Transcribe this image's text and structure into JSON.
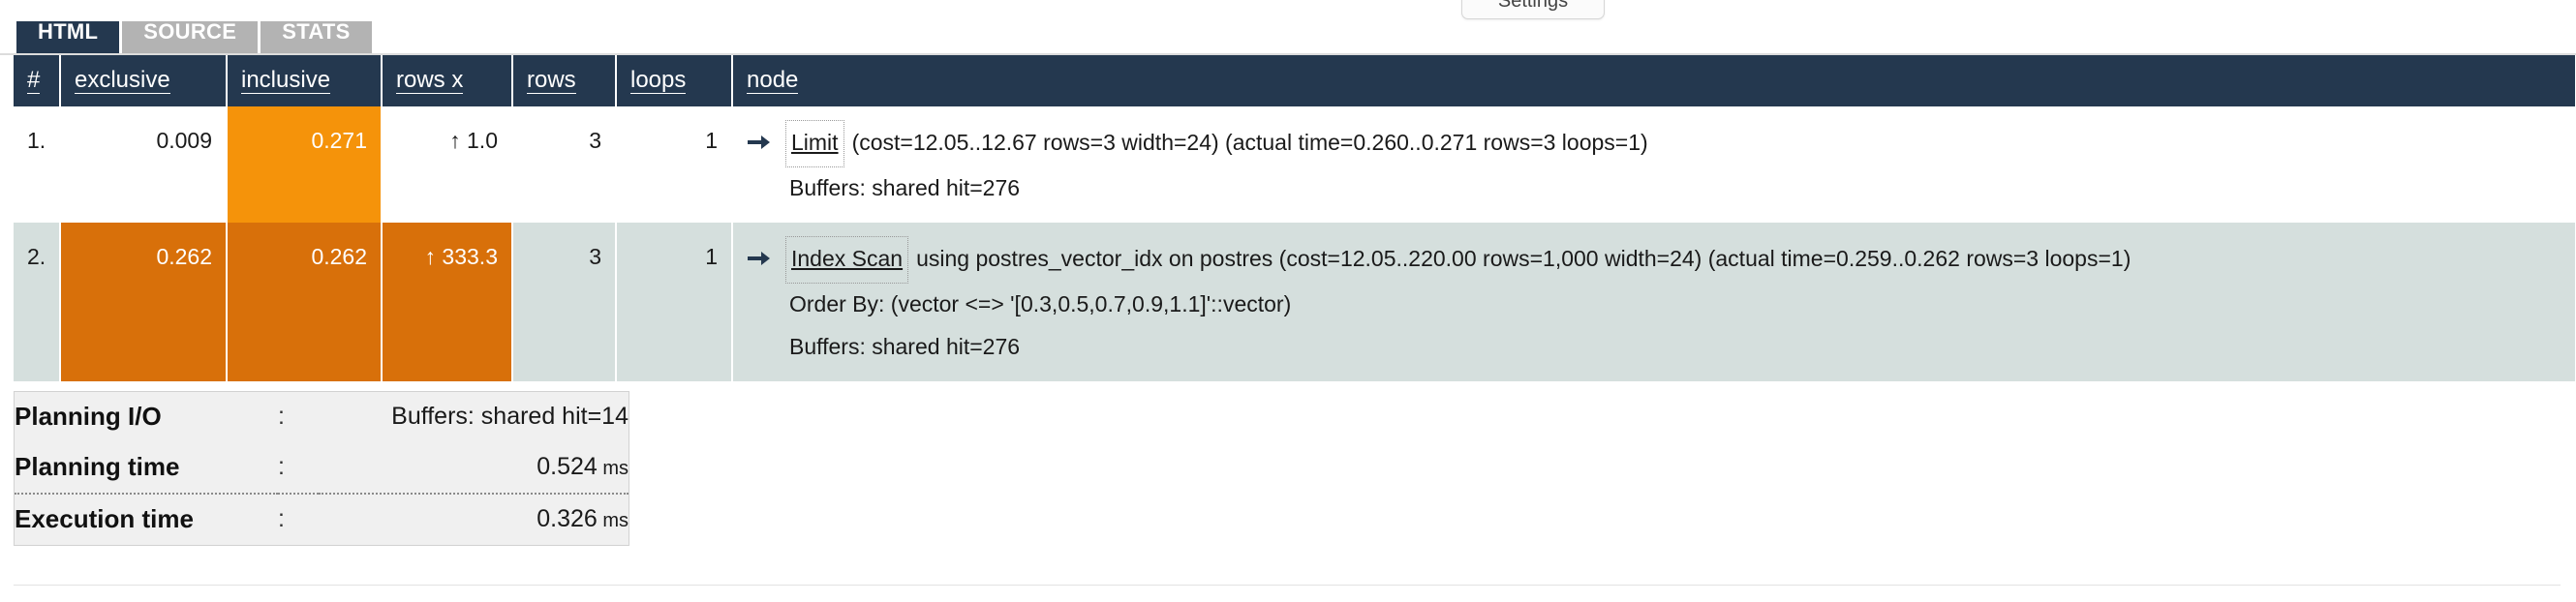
{
  "toolbar": {
    "settings_label": "Settings"
  },
  "tabs": [
    {
      "label": "HTML",
      "active": true
    },
    {
      "label": "SOURCE",
      "active": false
    },
    {
      "label": "STATS",
      "active": false
    }
  ],
  "plan_table": {
    "columns": [
      "#",
      "exclusive",
      "inclusive",
      "rows x",
      "rows",
      "loops",
      "node"
    ],
    "rows": [
      {
        "num": "1.",
        "exclusive": "0.009",
        "inclusive": "0.271",
        "rows_x": "↑ 1.0",
        "rows": "3",
        "loops": "1",
        "node_type": "Limit",
        "node_detail": "(cost=12.05..12.67 rows=3 width=24) (actual time=0.260..0.271 rows=3 loops=1)",
        "extra_lines": [
          "Buffers: shared hit=276"
        ],
        "exclusive_highlight": "none",
        "inclusive_highlight": "orange",
        "rows_x_highlight": "none"
      },
      {
        "num": "2.",
        "exclusive": "0.262",
        "inclusive": "0.262",
        "rows_x": "↑ 333.3",
        "rows": "3",
        "loops": "1",
        "node_type": "Index Scan",
        "node_detail": "using postres_vector_idx on postres (cost=12.05..220.00 rows=1,000 width=24) (actual time=0.259..0.262 rows=3 loops=1)",
        "extra_lines": [
          "Order By: (vector <=> '[0.3,0.5,0.7,0.9,1.1]'::vector)",
          "Buffers: shared hit=276"
        ],
        "exclusive_highlight": "dark",
        "inclusive_highlight": "dark",
        "rows_x_highlight": "dark"
      }
    ]
  },
  "summary": {
    "rows": [
      {
        "label": "Planning I/O",
        "colon": ":",
        "value": "Buffers: shared hit=14",
        "unit": ""
      },
      {
        "label": "Planning time",
        "colon": ":",
        "value": "0.524",
        "unit": " ms"
      },
      {
        "label": "Execution time",
        "colon": ":",
        "value": "0.326",
        "unit": " ms"
      }
    ]
  },
  "colors": {
    "header_bg": "#24384f",
    "tab_inactive": "#b3b3b3",
    "highlight_orange": "#f5930a",
    "highlight_dark_orange": "#d8700a",
    "row_even_bg": "#d5dfdd",
    "summary_bg": "#f0f0f0"
  },
  "icons": {
    "node_arrow": "➡",
    "sort_up": "↑"
  }
}
